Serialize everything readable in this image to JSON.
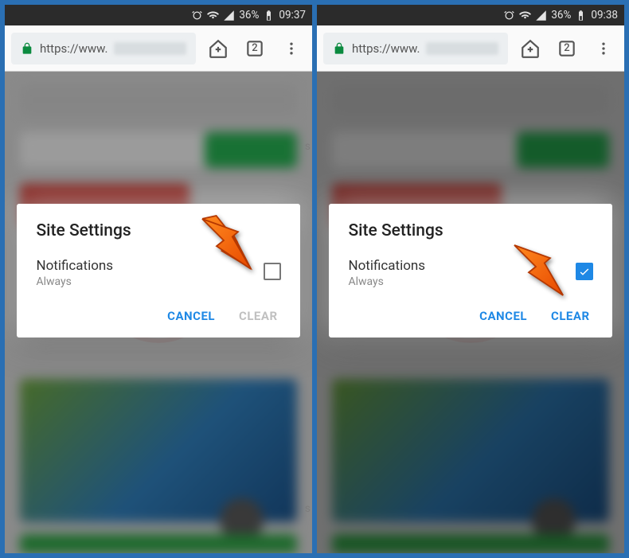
{
  "panes": [
    {
      "status": {
        "battery": "36%",
        "time": "09:37"
      },
      "url": {
        "scheme": "https://www.",
        "tab_count": "2"
      },
      "dialog": {
        "title": "Site Settings",
        "item_label": "Notifications",
        "item_sub": "Always",
        "checkbox_checked": false,
        "cancel": "CANCEL",
        "clear": "CLEAR",
        "clear_enabled": false
      }
    },
    {
      "status": {
        "battery": "36%",
        "time": "09:38"
      },
      "url": {
        "scheme": "https://www.",
        "tab_count": "2"
      },
      "dialog": {
        "title": "Site Settings",
        "item_label": "Notifications",
        "item_sub": "Always",
        "checkbox_checked": true,
        "cancel": "CANCEL",
        "clear": "CLEAR",
        "clear_enabled": true
      }
    }
  ]
}
